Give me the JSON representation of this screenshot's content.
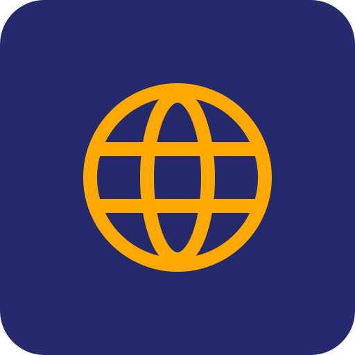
{
  "app_icon": {
    "icon": "globe-icon",
    "background_color": "#242a6b",
    "glyph_color": "#ffa800"
  }
}
